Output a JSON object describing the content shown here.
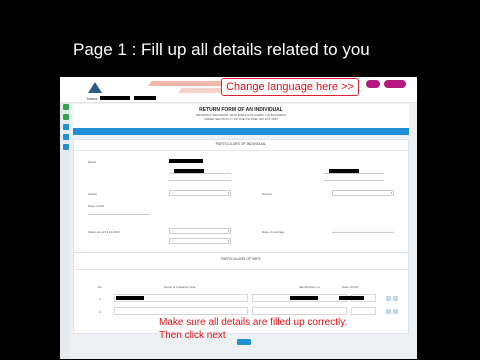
{
  "caption": "Page 1 : Fill up all details related to you",
  "header": {
    "change_language": "Change language here >>"
  },
  "form": {
    "title": "RETURN FORM OF AN INDIVIDUAL",
    "subtitle_lines": [
      "RESIDENT INDIVIDUAL WHO DOES NOT CARRY ON BUSINESS",
      "UNDER SECTION 77 OF THE INCOME TAX ACT 1967"
    ],
    "name_label": "Name",
    "particulars_title": "PARTICULARS OF INDIVIDUAL",
    "fields": {
      "name": "Name",
      "citizen": "Citizen",
      "date_of_birth": "Date of birth",
      "status": "Status as at 31.12.2020",
      "date_of_marriage": "Date of marriage",
      "gender": "Gender"
    },
    "wife_title": "PARTICULARS OF WIFE",
    "wife_headers": [
      "No",
      "Name of husband / wife",
      "Identification no.",
      "Date of birth"
    ],
    "wife_rows": [
      "1",
      "2"
    ]
  },
  "annotation": {
    "line1": "Make sure all details are filled up correctly.",
    "line2": "Then click next"
  },
  "colors": {
    "accent_blue": "#1f8fd6",
    "annotation_red": "#e21414",
    "user_button": "#b5177f"
  }
}
